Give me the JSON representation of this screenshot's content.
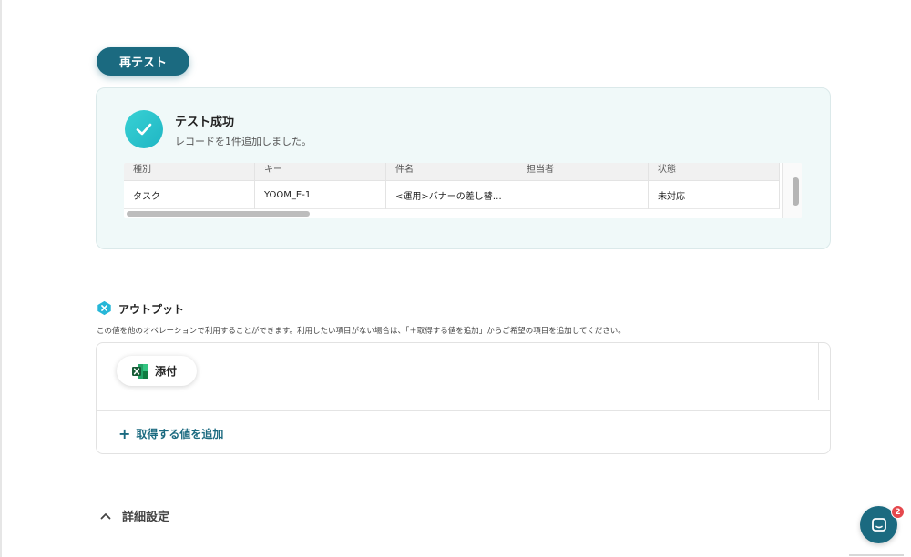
{
  "retest": {
    "label": "再テスト"
  },
  "result": {
    "title": "テスト成功",
    "subtitle": "レコードを1件追加しました。",
    "table": {
      "headers": [
        "種別",
        "キー",
        "件名",
        "担当者",
        "状態"
      ],
      "rows": [
        [
          "タスク",
          "YOOM_E-1",
          "<運用>バナーの差し替…",
          "",
          "未対応"
        ]
      ]
    }
  },
  "output": {
    "title": "アウトプット",
    "description": "この値を他のオペレーションで利用することができます。利用したい項目がない場合は、「＋取得する値を追加」からご希望の項目を追加してください。",
    "chip_label": "添付",
    "add_label": "取得する値を追加"
  },
  "details": {
    "label": "詳細設定"
  },
  "chat": {
    "badge_count": "2"
  },
  "colors": {
    "primary": "#1b6a80",
    "success": "#2cc4cc",
    "badge": "#e5484d",
    "excel": "#1e7145"
  },
  "icons": {
    "check": "check-icon",
    "output": "output-icon",
    "excel": "excel-icon",
    "plus": "plus-icon",
    "chevron": "chevron-up-icon",
    "chat": "chat-icon"
  }
}
